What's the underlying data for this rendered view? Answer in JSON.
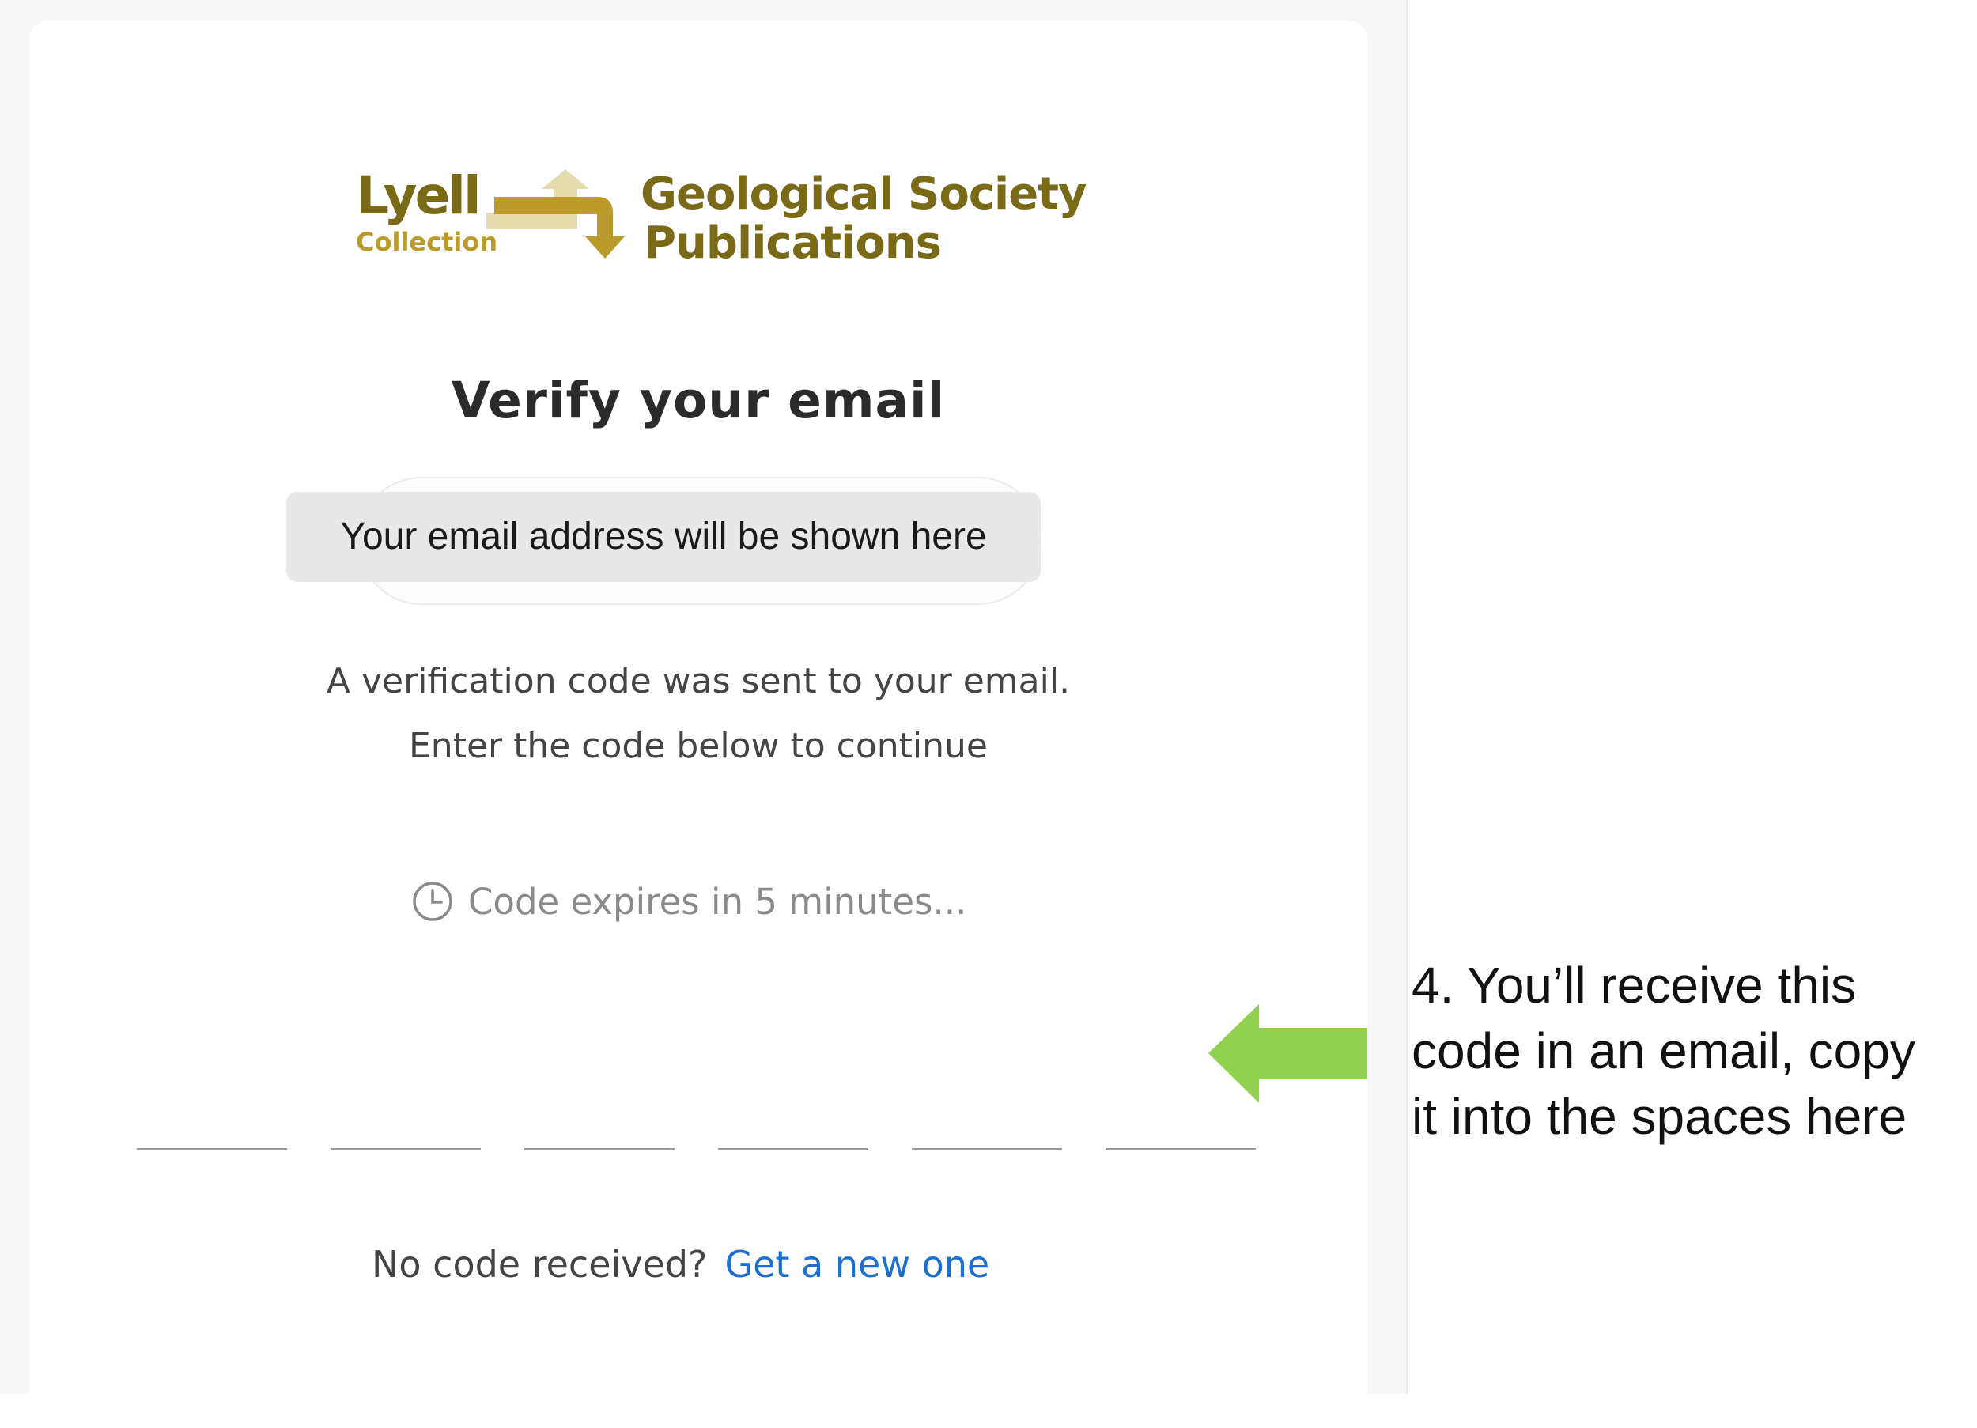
{
  "logo": {
    "lyell": "Lyell",
    "collection": "Collection",
    "gsp_line1": "Geological Society",
    "gsp_line2": "Publications",
    "icon": "lyell-arrow-logo-icon"
  },
  "title": "Verify your email",
  "email_placeholder": "Your email address will be shown here",
  "description": {
    "line1": "A verification code was sent to your email.",
    "line2": "Enter the code below to continue"
  },
  "expiry": {
    "icon": "clock-icon",
    "text": "Code expires in 5 minutes..."
  },
  "code_inputs": [
    "",
    "",
    "",
    "",
    "",
    ""
  ],
  "resend": {
    "prompt": "No code received?",
    "link": "Get a new one"
  },
  "annotation": {
    "line1": "4. You’ll receive this",
    "line2": "code in an email, copy",
    "line3": "it into the spaces here",
    "arrow_color": "#92d050"
  },
  "colors": {
    "brand_gold": "#b99a2a",
    "brand_olive": "#7a6a18",
    "link": "#1a6fd1"
  }
}
